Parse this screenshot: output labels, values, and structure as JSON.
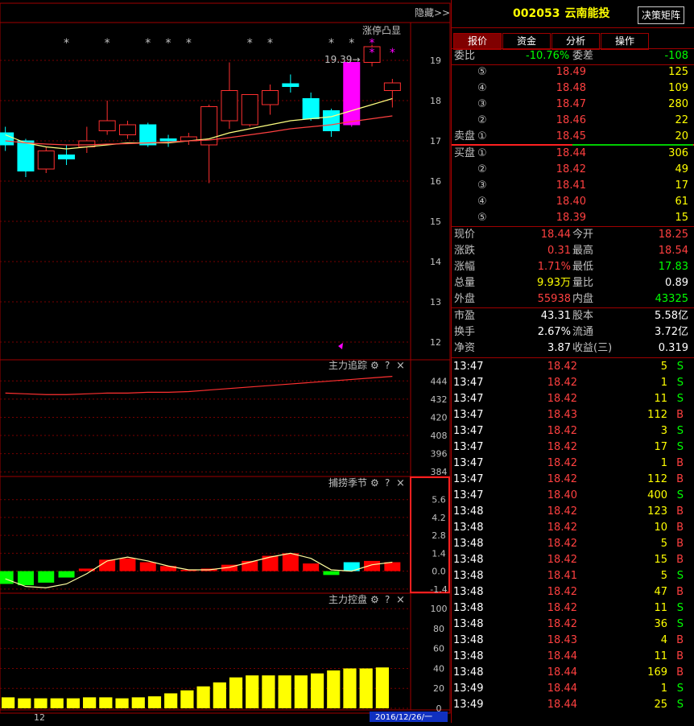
{
  "chart": {
    "hide_label": "隐藏>>",
    "zt_label": "涨停凸显",
    "high_mark": "19.39→",
    "star": "*",
    "price_axis": [
      "19",
      "18",
      "17",
      "16",
      "15",
      "14",
      "13",
      "12"
    ],
    "ind1": {
      "title": "主力追踪",
      "axis": [
        "444",
        "432",
        "420",
        "408",
        "396",
        "384"
      ]
    },
    "ind2": {
      "title": "捕捞季节",
      "axis": [
        "5.6",
        "4.2",
        "2.8",
        "1.4",
        "0.0",
        "-1.4"
      ]
    },
    "ind3": {
      "title": "主力控盘",
      "axis": [
        "100",
        "80",
        "60",
        "40",
        "20",
        "0"
      ]
    },
    "gear": "⚙",
    "help": "?",
    "close": "×",
    "bottom_label": "12",
    "date_label": "2016/12/26/一"
  },
  "chart_data": {
    "type": "candlestick",
    "ylim": [
      11.6,
      19.9
    ],
    "candles": [
      [
        17.2,
        16.9,
        17.35,
        16.75
      ],
      [
        17.0,
        16.25,
        17.05,
        16.1
      ],
      [
        16.3,
        16.75,
        16.85,
        16.2
      ],
      [
        16.65,
        16.55,
        16.9,
        16.4
      ],
      [
        16.85,
        17.0,
        17.35,
        16.7
      ],
      [
        17.25,
        17.5,
        18.0,
        17.15
      ],
      [
        17.15,
        17.4,
        17.5,
        17.05
      ],
      [
        17.4,
        16.9,
        17.45,
        16.85
      ],
      [
        17.05,
        17.0,
        17.15,
        16.85
      ],
      [
        17.0,
        17.1,
        17.2,
        16.9
      ],
      [
        16.9,
        17.85,
        17.9,
        15.95
      ],
      [
        17.5,
        18.25,
        18.95,
        17.3
      ],
      [
        17.4,
        18.15,
        18.15,
        17.35
      ],
      [
        17.9,
        18.25,
        18.4,
        17.65
      ],
      [
        18.42,
        18.35,
        18.65,
        18.2
      ],
      [
        18.05,
        17.55,
        18.2,
        17.5
      ],
      [
        17.75,
        17.25,
        17.8,
        17.1
      ],
      [
        17.4,
        18.95,
        18.95,
        17.35
      ],
      [
        18.95,
        19.34,
        19.39,
        18.85
      ],
      [
        18.25,
        18.44,
        18.54,
        17.83
      ]
    ],
    "ma_fast": [
      17.15,
      16.95,
      16.85,
      16.8,
      16.85,
      16.9,
      16.95,
      16.95,
      16.95,
      17.0,
      17.05,
      17.2,
      17.3,
      17.4,
      17.5,
      17.55,
      17.6,
      17.75,
      17.9,
      18.05
    ],
    "ma_slow": [
      17.0,
      16.95,
      16.92,
      16.9,
      16.9,
      16.92,
      16.93,
      16.95,
      16.97,
      17.0,
      17.02,
      17.08,
      17.15,
      17.22,
      17.3,
      17.35,
      17.4,
      17.48,
      17.55,
      17.62
    ],
    "stars": [
      false,
      false,
      false,
      true,
      false,
      true,
      false,
      true,
      true,
      true,
      false,
      false,
      true,
      true,
      false,
      false,
      true,
      true,
      true,
      false
    ],
    "star_colors": [
      "#c0c0c0",
      "#c0c0c0",
      "#c0c0c0",
      "#c0c0c0",
      "#c0c0c0",
      "#c0c0c0",
      "#c0c0c0",
      "#c0c0c0",
      "#c0c0c0",
      "#c0c0c0",
      "#c0c0c0",
      "#c0c0c0",
      "#c0c0c0",
      "#c0c0c0",
      "#c0c0c0",
      "#c0c0c0",
      "#c0c0c0",
      "#c0c0c0",
      "#ff00ff",
      "#ff00ff"
    ],
    "ind1_line": [
      436,
      435.5,
      435,
      435,
      435.5,
      436,
      436,
      436.5,
      436.5,
      437,
      438,
      439,
      440,
      441,
      442,
      443,
      444,
      445,
      446,
      447
    ],
    "ind1_ylim": [
      382,
      450
    ],
    "ind2_bars": [
      -1.0,
      -1.1,
      -0.9,
      -0.5,
      0.2,
      0.9,
      1.0,
      0.7,
      0.4,
      0.1,
      0.2,
      0.5,
      0.8,
      1.2,
      1.4,
      0.6,
      -0.3,
      0.7,
      0.8,
      0.7
    ],
    "ind2_line": [
      -0.6,
      -1.2,
      -1.3,
      -1.0,
      -0.2,
      0.8,
      1.1,
      0.8,
      0.4,
      0.1,
      0.1,
      0.3,
      0.7,
      1.1,
      1.4,
      1.0,
      0.1,
      0.0,
      0.5,
      0.7
    ],
    "ind2_ylim": [
      -1.6,
      6.4
    ],
    "ind3_bars": [
      11,
      10,
      10,
      10,
      10,
      11,
      11,
      10,
      11,
      12,
      15,
      18,
      22,
      26,
      31,
      33,
      33,
      33,
      33,
      35,
      38,
      40,
      40,
      41
    ],
    "ind3_ylim": [
      0,
      105
    ]
  },
  "quote": {
    "code": "002053",
    "name": "云南能投",
    "decision_btn": "决策矩阵",
    "tabs": [
      "报价",
      "资金",
      "分析",
      "操作"
    ],
    "weibi_label": "委比",
    "weibi_value": "-10.76%",
    "weicha_label": "委差",
    "weicha_value": "-108",
    "sell_label": "卖盘",
    "buy_label": "买盘",
    "asks": [
      {
        "lvl": "5",
        "price": "18.49",
        "vol": "125"
      },
      {
        "lvl": "4",
        "price": "18.48",
        "vol": "109"
      },
      {
        "lvl": "3",
        "price": "18.47",
        "vol": "280"
      },
      {
        "lvl": "2",
        "price": "18.46",
        "vol": "22"
      },
      {
        "lvl": "1",
        "price": "18.45",
        "vol": "20"
      }
    ],
    "bids": [
      {
        "lvl": "1",
        "price": "18.44",
        "vol": "306"
      },
      {
        "lvl": "2",
        "price": "18.42",
        "vol": "49"
      },
      {
        "lvl": "3",
        "price": "18.41",
        "vol": "17"
      },
      {
        "lvl": "4",
        "price": "18.40",
        "vol": "61"
      },
      {
        "lvl": "5",
        "price": "18.39",
        "vol": "15"
      }
    ],
    "stats": [
      {
        "l1": "现价",
        "v1": "18.44",
        "c1": "red",
        "l2": "今开",
        "v2": "18.25",
        "c2": "red"
      },
      {
        "l1": "涨跌",
        "v1": "0.31",
        "c1": "red",
        "l2": "最高",
        "v2": "18.54",
        "c2": "red"
      },
      {
        "l1": "涨幅",
        "v1": "1.71%",
        "c1": "red",
        "l2": "最低",
        "v2": "17.83",
        "c2": "green"
      },
      {
        "l1": "总量",
        "v1": "9.93万",
        "c1": "yellow",
        "l2": "量比",
        "v2": "0.89",
        "c2": "white"
      },
      {
        "l1": "外盘",
        "v1": "55938",
        "c1": "red",
        "l2": "内盘",
        "v2": "43325",
        "c2": "green"
      }
    ],
    "finance": [
      {
        "l1": "市盈",
        "v1": "43.31",
        "l2": "股本",
        "v2": "5.58亿"
      },
      {
        "l1": "换手",
        "v1": "2.67%",
        "l2": "流通",
        "v2": "3.72亿"
      },
      {
        "l1": "净资",
        "v1": "3.87",
        "l2": "收益(三)",
        "v2": "0.319"
      }
    ],
    "ticks": [
      {
        "t": "13:47",
        "p": "18.42",
        "v": "5",
        "d": "S"
      },
      {
        "t": "13:47",
        "p": "18.42",
        "v": "1",
        "d": "S"
      },
      {
        "t": "13:47",
        "p": "18.42",
        "v": "11",
        "d": "S"
      },
      {
        "t": "13:47",
        "p": "18.43",
        "v": "112",
        "d": "B"
      },
      {
        "t": "13:47",
        "p": "18.42",
        "v": "3",
        "d": "S"
      },
      {
        "t": "13:47",
        "p": "18.42",
        "v": "17",
        "d": "S"
      },
      {
        "t": "13:47",
        "p": "18.42",
        "v": "1",
        "d": "B"
      },
      {
        "t": "13:47",
        "p": "18.42",
        "v": "112",
        "d": "B"
      },
      {
        "t": "13:47",
        "p": "18.40",
        "v": "400",
        "d": "S"
      },
      {
        "t": "13:48",
        "p": "18.42",
        "v": "123",
        "d": "B"
      },
      {
        "t": "13:48",
        "p": "18.42",
        "v": "10",
        "d": "B"
      },
      {
        "t": "13:48",
        "p": "18.42",
        "v": "5",
        "d": "B"
      },
      {
        "t": "13:48",
        "p": "18.42",
        "v": "15",
        "d": "B"
      },
      {
        "t": "13:48",
        "p": "18.41",
        "v": "5",
        "d": "S"
      },
      {
        "t": "13:48",
        "p": "18.42",
        "v": "47",
        "d": "B"
      },
      {
        "t": "13:48",
        "p": "18.42",
        "v": "11",
        "d": "S"
      },
      {
        "t": "13:48",
        "p": "18.42",
        "v": "36",
        "d": "S"
      },
      {
        "t": "13:48",
        "p": "18.43",
        "v": "4",
        "d": "B"
      },
      {
        "t": "13:48",
        "p": "18.44",
        "v": "11",
        "d": "B"
      },
      {
        "t": "13:48",
        "p": "18.44",
        "v": "169",
        "d": "B"
      },
      {
        "t": "13:49",
        "p": "18.44",
        "v": "1",
        "d": "S"
      },
      {
        "t": "13:49",
        "p": "18.44",
        "v": "25",
        "d": "S"
      }
    ]
  },
  "colors": {
    "up": "#ff3030",
    "down": "#00ffff",
    "frame": "#a00000",
    "grid": "#7a0000",
    "buy": "#ff4040",
    "sell": "#00ff00"
  }
}
